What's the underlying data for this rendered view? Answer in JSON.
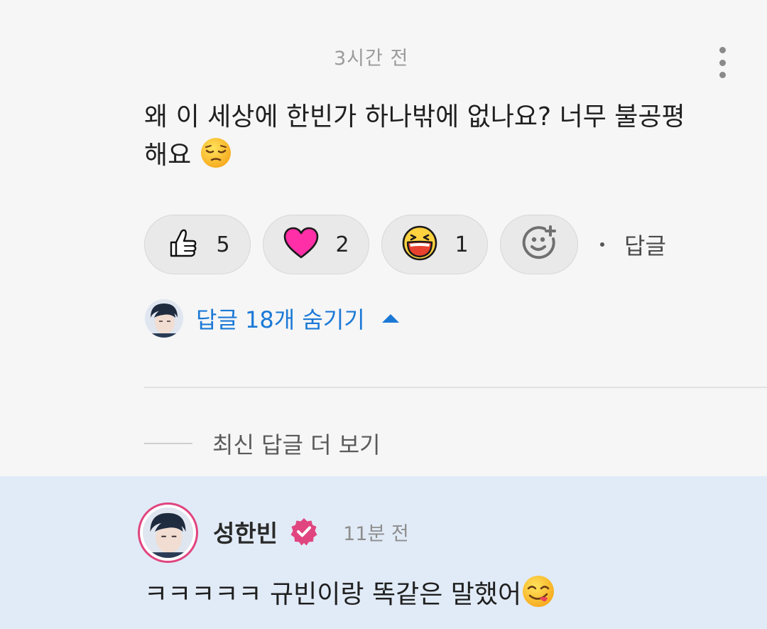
{
  "comment": {
    "timestamp": "3시간 전",
    "text_line1": "왜 이 세상에 한빈가 하나밖에 없나요? 너무 불공평",
    "text_line2": "해요",
    "emoji": "pensive-face"
  },
  "reactions": [
    {
      "icon": "thumbs-up-icon",
      "count": "5"
    },
    {
      "icon": "heart-icon",
      "count": "2"
    },
    {
      "icon": "laughing-face-icon",
      "count": "1"
    }
  ],
  "actions": {
    "reply_label": "답글"
  },
  "replies": {
    "toggle_label": "답글 18개 숨기기",
    "more_label": "최신 답글 더 보기"
  },
  "reply": {
    "author": "성한빈",
    "timestamp": "11분 전",
    "text": "ㅋㅋㅋㅋㅋ 규빈이랑 똑같은 말했어",
    "emoji": "yum-face"
  },
  "colors": {
    "accent_blue": "#1b79d6",
    "highlight_bg": "#e1ebf7",
    "verified_pink": "#e0457f",
    "heart": "#ff2fa7"
  }
}
